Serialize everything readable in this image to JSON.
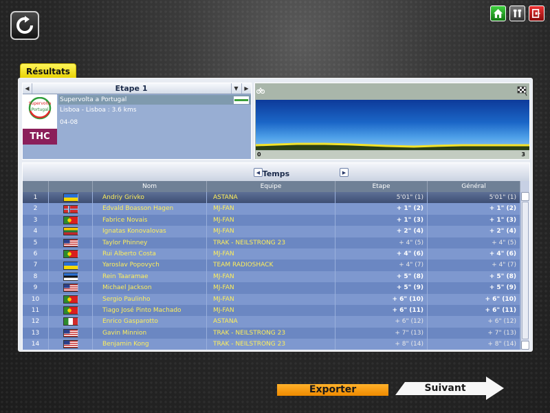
{
  "tab_label": "Résultats",
  "stage": {
    "label": "Etape 1",
    "race_name": "Supervolta a Portugal",
    "route": "Lisboa - Lisboa : 3.6 kms",
    "date": "04-08",
    "logo_text_top": "Supervolta",
    "logo_text_bottom": "Portugal",
    "team_code": "THC"
  },
  "profile": {
    "axis_start": "0",
    "axis_end": "3"
  },
  "results": {
    "title": "Temps",
    "columns": [
      "",
      "",
      "Nom",
      "Equipe",
      "Etape",
      "Général"
    ],
    "rows": [
      {
        "pos": "1",
        "flag": "ukraine",
        "name": "Andriy Grivko",
        "team": "ASTANA",
        "etape": "5'01\" (1)",
        "general": "5'01\" (1)",
        "bold": false
      },
      {
        "pos": "2",
        "flag": "norway",
        "name": "Edvald Boasson Hagen",
        "team": "MJ-FAN",
        "etape": "+ 1\" (2)",
        "general": "+ 1\" (2)",
        "bold": true
      },
      {
        "pos": "3",
        "flag": "portugal",
        "name": "Fabrice Novais",
        "team": "MJ-FAN",
        "etape": "+ 1\" (3)",
        "general": "+ 1\" (3)",
        "bold": true
      },
      {
        "pos": "4",
        "flag": "lithuania",
        "name": "Ignatas Konovalovas",
        "team": "MJ-FAN",
        "etape": "+ 2\" (4)",
        "general": "+ 2\" (4)",
        "bold": true
      },
      {
        "pos": "5",
        "flag": "usa",
        "name": "Taylor Phinney",
        "team": "TRAK - NEILSTRONG 23",
        "etape": "+ 4\" (5)",
        "general": "+ 4\" (5)",
        "bold": false
      },
      {
        "pos": "6",
        "flag": "portugal",
        "name": "Rui Alberto Costa",
        "team": "MJ-FAN",
        "etape": "+ 4\" (6)",
        "general": "+ 4\" (6)",
        "bold": true
      },
      {
        "pos": "7",
        "flag": "ukraine",
        "name": "Yaroslav Popovych",
        "team": "TEAM RADIOSHACK",
        "etape": "+ 4\" (7)",
        "general": "+ 4\" (7)",
        "bold": false
      },
      {
        "pos": "8",
        "flag": "estonia",
        "name": "Rein Taaramae",
        "team": "MJ-FAN",
        "etape": "+ 5\" (8)",
        "general": "+ 5\" (8)",
        "bold": true
      },
      {
        "pos": "9",
        "flag": "usa",
        "name": "Michael Jackson",
        "team": "MJ-FAN",
        "etape": "+ 5\" (9)",
        "general": "+ 5\" (9)",
        "bold": true
      },
      {
        "pos": "10",
        "flag": "portugal",
        "name": "Sergio Paulinho",
        "team": "MJ-FAN",
        "etape": "+ 6\" (10)",
        "general": "+ 6\" (10)",
        "bold": true
      },
      {
        "pos": "11",
        "flag": "portugal",
        "name": "Tiago José Pinto Machado",
        "team": "MJ-FAN",
        "etape": "+ 6\" (11)",
        "general": "+ 6\" (11)",
        "bold": true
      },
      {
        "pos": "12",
        "flag": "italy",
        "name": "Enrico Gasparotto",
        "team": "ASTANA",
        "etape": "+ 6\" (12)",
        "general": "+ 6\" (12)",
        "bold": false
      },
      {
        "pos": "13",
        "flag": "usa",
        "name": "Gavin Minnion",
        "team": "TRAK - NEILSTRONG 23",
        "etape": "+ 7\" (13)",
        "general": "+ 7\" (13)",
        "bold": false
      },
      {
        "pos": "14",
        "flag": "usa",
        "name": "Benjamin Kong",
        "team": "TRAK - NEILSTRONG 23",
        "etape": "+ 8\" (14)",
        "general": "+ 8\" (14)",
        "bold": false
      }
    ]
  },
  "buttons": {
    "export": "Exporter",
    "next": "Suivant"
  },
  "icons": {
    "refresh": "refresh-icon",
    "home": "home-icon",
    "tools": "tools-icon",
    "exit": "exit-icon",
    "finish": "checkered-flag-icon",
    "climb": "climb-icon"
  },
  "colors": {
    "tab": "#f2e200",
    "row_odd": "#6b87c2",
    "row_even": "#7e98cf",
    "name_text": "#ffef5a",
    "export_button": "#f79a10"
  }
}
